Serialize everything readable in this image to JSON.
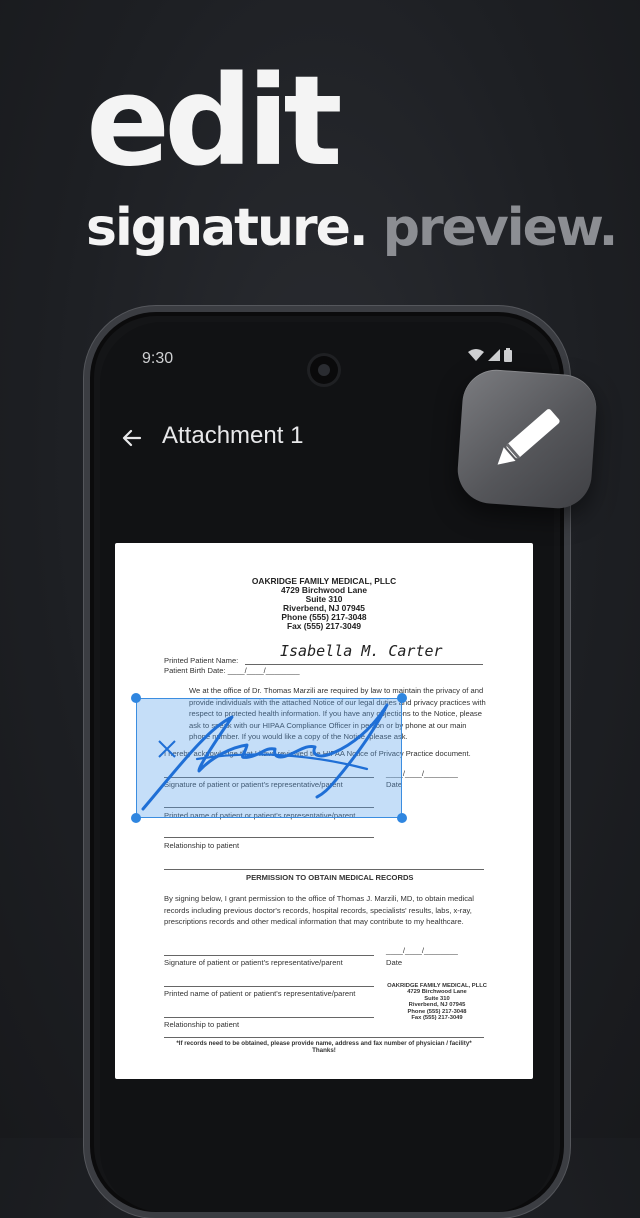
{
  "headline": {
    "line1": "edit",
    "line2_a": "signature.",
    "line2_b": "preview."
  },
  "status_bar": {
    "time": "9:30",
    "icons": [
      "wifi-icon",
      "signal-icon",
      "battery-icon"
    ]
  },
  "app_bar": {
    "title": "Attachment 1",
    "back_icon": "arrow-left-icon"
  },
  "action_icon": "pencil-icon",
  "document": {
    "header": [
      "OAKRIDGE FAMILY MEDICAL, PLLC",
      "4729 Birchwood Lane",
      "Suite 310",
      "Riverbend, NJ 07945",
      "Phone (555) 217-3048",
      "Fax (555) 217-3049"
    ],
    "printed_patient_name_label": "Printed Patient Name:",
    "printed_patient_name_value": "Isabella M. Carter",
    "patient_birth_date_label": "Patient Birth Date:",
    "date_blank": "____/____/________",
    "privacy_paragraph": "We at the office of Dr. Thomas Marzili are required by law to maintain the privacy of and provide individuals with the attached Notice of our legal duties and privacy practices with respect to protected health information.  If you have any objections to the Notice, please ask to speak with our HIPAA Compliance Officer in person or by phone at our main phone number.  If you would like a copy of the Notice, please ask.",
    "acknowledge": "I hereby acknowledge that I have reviewed the HIPAA Notice of Privacy Practice document.",
    "signature_label": "Signature of patient or patient's representative/parent",
    "date_label": "Date",
    "printed_name_label": "Printed name of patient or patient's representative/parent",
    "relationship_label": "Relationship to patient",
    "permission_title": "PERMISSION TO OBTAIN MEDICAL RECORDS",
    "permission_paragraph": "By signing below, I grant permission to the office of Thomas J. Marzili, MD, to obtain medical records including previous doctor's records, hospital records, specialists' results, labs, x-ray, prescriptions records and other medical information that may contribute to my healthcare.",
    "date_blank2": "____/____/________",
    "footer_address": [
      "OAKRIDGE FAMILY MEDICAL, PLLC",
      "4729 Birchwood Lane",
      "Suite 310",
      "Riverbend, NJ 07945",
      "Phone (555) 217-3048",
      "Fax (555) 217-3049"
    ],
    "footnote_line1": "*If records need to be obtained, please provide name, address and fax number of physician / facility*",
    "footnote_line2": "Thanks!"
  },
  "colors": {
    "selection": "#3b8de0",
    "ink": "#1f6fd6"
  }
}
